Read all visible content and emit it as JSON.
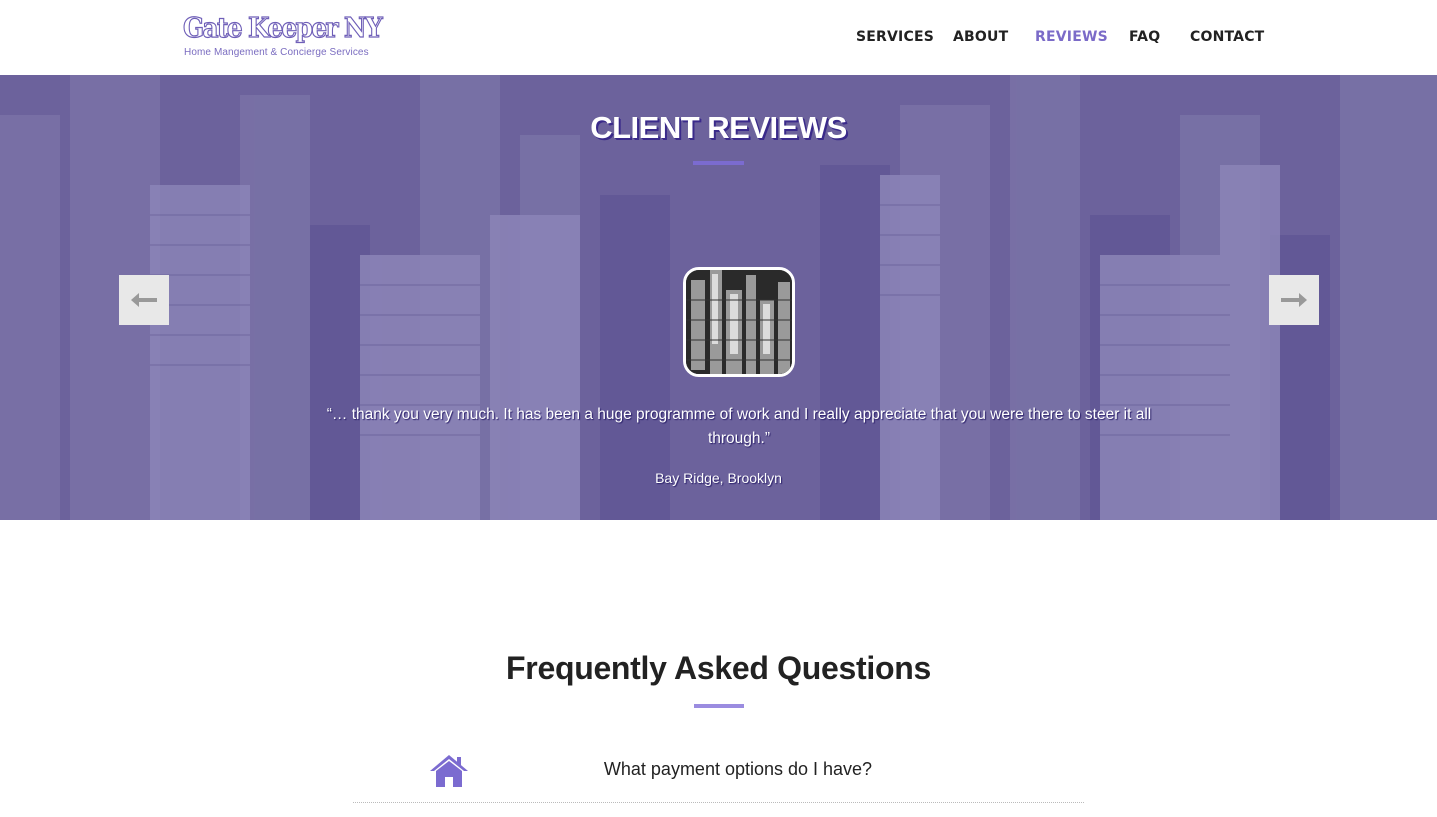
{
  "header": {
    "logo_title": "Gate Keeper NY",
    "logo_subtitle": "Home Mangement & Concierge Services",
    "nav": [
      {
        "label": "SERVICES",
        "active": false
      },
      {
        "label": "ABOUT",
        "active": false
      },
      {
        "label": "REVIEWS",
        "active": true
      },
      {
        "label": "FAQ",
        "active": false
      },
      {
        "label": "CONTACT",
        "active": false
      }
    ]
  },
  "reviews": {
    "title": "CLIENT REVIEWS",
    "prev_icon": "arrow-left-icon",
    "next_icon": "arrow-right-icon",
    "quote": "“… thank you very much.  It has been a huge programme of work and I really appreciate that you were there to steer it all through.”",
    "author": "Bay Ridge, Brooklyn"
  },
  "faq": {
    "title": "Frequently Asked Questions",
    "items": [
      {
        "icon": "home-icon",
        "question": "What payment options do I have?"
      }
    ]
  },
  "colors": {
    "accent": "#7b6bc8",
    "hero_overlay": "#6f659e",
    "text": "#222222"
  }
}
